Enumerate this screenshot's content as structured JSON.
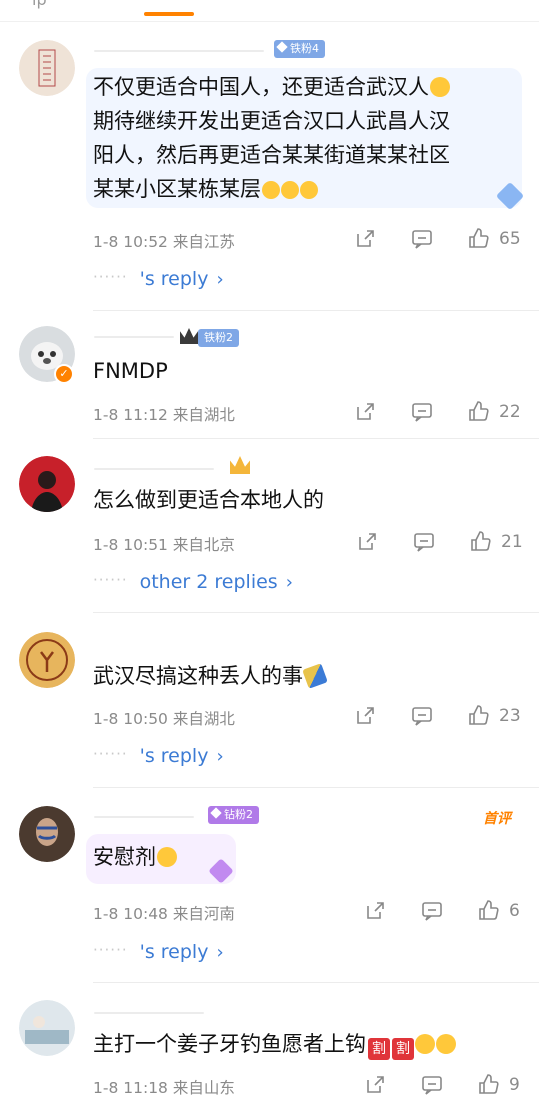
{
  "header": {
    "partial_tab_text": "ip"
  },
  "comments": [
    {
      "fan_badge": "铁粉4",
      "body_lines": [
        "不仅更适合中国人，还更适合武汉人",
        "期待继续开发出更适合汉口人武昌人汉",
        "阳人，然后再更适合某某街道某某社区",
        "某某小区某栋某层"
      ],
      "date": "1-8 10:52",
      "location": "来自江苏",
      "likes": "65",
      "replies": "'s reply"
    },
    {
      "fan_badge": "铁粉2",
      "body_lines": [
        "FNMDP"
      ],
      "date": "1-8 11:12",
      "location": "来自湖北",
      "likes": "22"
    },
    {
      "body_lines": [
        "怎么做到更适合本地人的"
      ],
      "date": "1-8 10:51",
      "location": "来自北京",
      "likes": "21",
      "replies": "other 2 replies"
    },
    {
      "body_lines": [
        "武汉尽搞这种丢人的事"
      ],
      "date": "1-8 10:50",
      "location": "来自湖北",
      "likes": "23",
      "replies": "'s reply"
    },
    {
      "fan_badge": "钻粉2",
      "tag": "首评",
      "body_lines": [
        "安慰剂"
      ],
      "date": "1-8 10:48",
      "location": "来自河南",
      "likes": "6",
      "replies": "'s reply"
    },
    {
      "body_lines": [
        "主打一个姜子牙钓鱼愿者上钩"
      ],
      "inline_tags": [
        "割",
        "割"
      ],
      "date": "1-8 11:18",
      "location": "来自山东",
      "likes": "9"
    }
  ],
  "colors": {
    "accent": "#ff8200",
    "link": "#3c7bd4",
    "meta": "#8a8a8a"
  },
  "icons": {
    "share": "share-icon",
    "comment": "comment-icon",
    "like": "thumb-up-icon"
  }
}
